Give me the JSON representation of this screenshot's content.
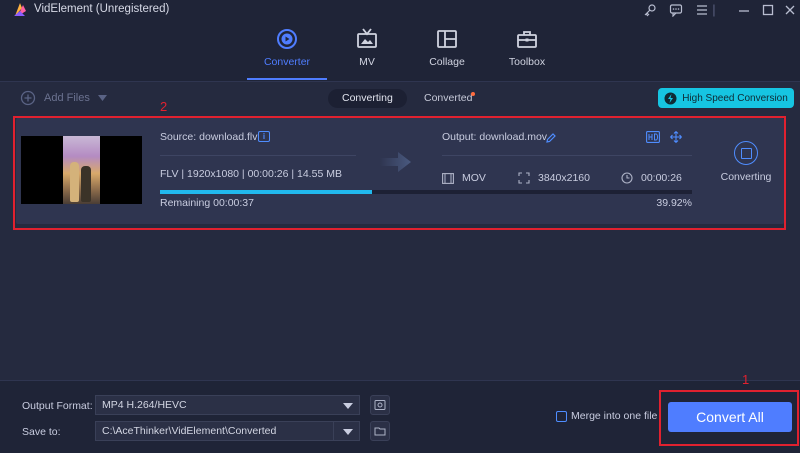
{
  "window": {
    "title": "VidElement (Unregistered)"
  },
  "nav": {
    "tabs": [
      {
        "label": "Converter",
        "active": true
      },
      {
        "label": "MV",
        "active": false
      },
      {
        "label": "Collage",
        "active": false
      },
      {
        "label": "Toolbox",
        "active": false
      }
    ]
  },
  "toolbar": {
    "add_files_label": "Add Files",
    "segments": [
      "Converting",
      "Converted"
    ],
    "high_speed_label": "High Speed Conversion"
  },
  "task": {
    "source": "Source: download.flv",
    "meta": "FLV | 1920x1080 | 00:00:26 | 14.55 MB",
    "output": "Output: download.mov",
    "out_format": "MOV",
    "out_resolution": "3840x2160",
    "out_duration": "00:00:26",
    "remaining": "Remaining 00:00:37",
    "percent_label": "39.92%",
    "progress_fraction": 0.3992,
    "status_label": "Converting"
  },
  "annotations": {
    "box_1_label": "1",
    "box_2_label": "2",
    "color": "#e0212f"
  },
  "bottom": {
    "output_format_label": "Output Format:",
    "output_format_value": "MP4 H.264/HEVC",
    "save_to_label": "Save to:",
    "save_to_value": "C:\\AceThinker\\VidElement\\Converted",
    "merge_label": "Merge into one file",
    "convert_all_label": "Convert All"
  },
  "colors": {
    "accent": "#4f7dff",
    "high_speed": "#16c5e2",
    "progress": "#21b9ee",
    "background": "#252a3f"
  },
  "icons": {
    "logo": "app-logo-icon",
    "window": [
      "key-icon",
      "feedback-icon",
      "menu-icon",
      "minimize-icon",
      "maximize-icon",
      "close-icon"
    ],
    "nav": [
      "converter-icon",
      "mv-icon",
      "collage-icon",
      "toolbox-icon"
    ]
  }
}
